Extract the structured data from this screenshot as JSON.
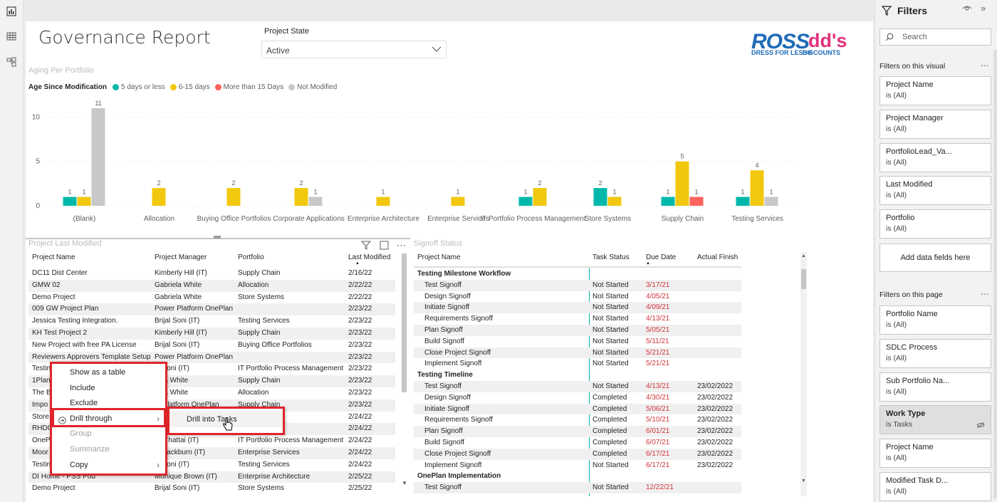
{
  "rail": {
    "icons": [
      "report-view-icon",
      "data-view-icon",
      "model-view-icon"
    ]
  },
  "report": {
    "title": "Governance Report"
  },
  "slicer": {
    "label": "Project State",
    "value": "Active"
  },
  "logo": {
    "ross": "ROSS",
    "ross_sub": "DRESS FOR LESS®",
    "dds": "dd's",
    "dds_sub": "DISCOUNTS"
  },
  "colors": {
    "five_days": "#01b8aa",
    "six_fifteen": "#f2c80f",
    "more_15": "#fd625e",
    "not_modified": "#c8c8c8",
    "accent_red": "#e0242b"
  },
  "chart_data": {
    "type": "bar",
    "title": "Aging Per Portfolio",
    "legend_title": "Age Since Modification",
    "legend_position": "top-left",
    "categories": [
      "(Blank)",
      "Allocation",
      "Buying Office Portfolios",
      "Corporate Applications",
      "Enterprise Architecture",
      "Enterprise Services",
      "IT Portfolio Process Management",
      "Store Systems",
      "Supply Chain",
      "Testing Services"
    ],
    "series": [
      {
        "name": "5 days or less",
        "values": [
          1,
          null,
          null,
          null,
          null,
          null,
          1,
          2,
          1,
          1
        ]
      },
      {
        "name": "6-15 days",
        "values": [
          1,
          2,
          2,
          2,
          1,
          1,
          2,
          1,
          5,
          4
        ]
      },
      {
        "name": "More than 15 Days",
        "values": [
          null,
          null,
          null,
          null,
          null,
          null,
          null,
          null,
          1,
          null
        ]
      },
      {
        "name": "Not Modified",
        "values": [
          11,
          null,
          null,
          1,
          null,
          null,
          null,
          null,
          null,
          1
        ]
      }
    ],
    "yticks": [
      0,
      5,
      10
    ],
    "ylim": [
      0,
      11
    ],
    "grid": true
  },
  "modified_table": {
    "title": "Project Last Modified",
    "columns": [
      "Project Name",
      "Project Manager",
      "Portfolio",
      "Last Modified"
    ],
    "rows": [
      [
        "DC11 Dist Center",
        "Kimberly Hill (IT)",
        "Supply Chain",
        "2/16/22"
      ],
      [
        "GMW 02",
        "Gabriela White",
        "Allocation",
        "2/22/22"
      ],
      [
        "Demo Project",
        "Gabriela White",
        "Store Systems",
        "2/22/22"
      ],
      [
        "009 GW Project Plan",
        "Power Platform OnePlan",
        "",
        "2/23/22"
      ],
      [
        "Jessica Testing Integration.",
        "Brijal Soni (IT)",
        "Testing Services",
        "2/23/22"
      ],
      [
        "KH Test Project 2",
        "Kimberly Hill (IT)",
        "Supply Chain",
        "2/23/22"
      ],
      [
        "New Project with free PA License",
        "Brijal Soni (IT)",
        "Buying Office Portfolios",
        "2/23/22"
      ],
      [
        "Reviewers Approvers Template Setup",
        "Power Platform OnePlan",
        "",
        "2/23/22"
      ],
      [
        "Testin",
        "al Soni (IT)",
        "IT Portfolio Process Management",
        "2/23/22"
      ],
      [
        "1Plan",
        "riela White",
        "Supply Chain",
        "2/23/22"
      ],
      [
        "The B",
        "riela White",
        "Allocation",
        "2/23/22"
      ],
      [
        "Impo",
        "er Platform OnePlan",
        "Supply Chain",
        "2/23/22"
      ],
      [
        "Store",
        "",
        "",
        "2/24/22"
      ],
      [
        "RHDC",
        "Simeona (IT)",
        "Supply Chain",
        "2/24/22"
      ],
      [
        "OneP",
        "ya Thattai (IT)",
        "IT Portfolio Process Management",
        "2/24/22"
      ],
      [
        "Moor",
        "n Blackburn (IT)",
        "Enterprise Services",
        "2/24/22"
      ],
      [
        "Testin",
        "al Soni (IT)",
        "Testing Services",
        "2/24/22"
      ],
      [
        "DI Home - PSS Pod",
        "Monique Brown (IT)",
        "Enterprise Architecture",
        "2/25/22"
      ],
      [
        "Demo Project",
        "Brijal Soni (IT)",
        "Store Systems",
        "2/25/22"
      ]
    ]
  },
  "signoff_table": {
    "title": "Signoff Status",
    "columns": [
      "Project Name",
      "Task Status",
      "Due Date",
      "Actual Finish"
    ],
    "rows": [
      {
        "group": "Testing Milestone Workflow"
      },
      {
        "name": "Test Signoff",
        "status": "Not Started",
        "due": "3/17/21",
        "finish": ""
      },
      {
        "name": "Design Signoff",
        "status": "Not Started",
        "due": "4/05/21",
        "finish": ""
      },
      {
        "name": "Initiate Signoff",
        "status": "Not Started",
        "due": "4/09/21",
        "finish": ""
      },
      {
        "name": "Requirements Signoff",
        "status": "Not Started",
        "due": "4/13/21",
        "finish": ""
      },
      {
        "name": "Plan Signoff",
        "status": "Not Started",
        "due": "5/05/21",
        "finish": ""
      },
      {
        "name": "Build Signoff",
        "status": "Not Started",
        "due": "5/11/21",
        "finish": ""
      },
      {
        "name": "Close Project Signoff",
        "status": "Not Started",
        "due": "5/21/21",
        "finish": ""
      },
      {
        "name": "Implement Signoff",
        "status": "Not Started",
        "due": "5/21/21",
        "finish": ""
      },
      {
        "group": "Testing Timeline"
      },
      {
        "name": "Test Signoff",
        "status": "Not Started",
        "due": "4/13/21",
        "finish": "23/02/2022"
      },
      {
        "name": "Design Signoff",
        "status": "Completed",
        "due": "4/30/21",
        "finish": "23/02/2022"
      },
      {
        "name": "Initiate Signoff",
        "status": "Completed",
        "due": "5/06/21",
        "finish": "23/02/2022"
      },
      {
        "name": "Requirements Signoff",
        "status": "Completed",
        "due": "5/10/21",
        "finish": "23/02/2022"
      },
      {
        "name": "Plan Signoff",
        "status": "Completed",
        "due": "6/01/21",
        "finish": "23/02/2022"
      },
      {
        "name": "Build Signoff",
        "status": "Completed",
        "due": "6/07/21",
        "finish": "23/02/2022"
      },
      {
        "name": "Close Project Signoff",
        "status": "Completed",
        "due": "6/17/21",
        "finish": "23/02/2022"
      },
      {
        "name": "Implement Signoff",
        "status": "Not Started",
        "due": "6/17/21",
        "finish": "23/02/2022"
      },
      {
        "group": "OnePlan Implementation"
      },
      {
        "name": "Test Signoff",
        "status": "Not Started",
        "due": "12/22/21",
        "finish": ""
      }
    ]
  },
  "context_menu": {
    "items": [
      {
        "label": "Show as a table",
        "disabled": false,
        "submenu": false
      },
      {
        "label": "Include",
        "disabled": false,
        "submenu": false
      },
      {
        "label": "Exclude",
        "disabled": false,
        "submenu": false
      },
      {
        "label": "Drill through",
        "disabled": false,
        "submenu": true
      },
      {
        "label": "Group",
        "disabled": true,
        "submenu": false
      },
      {
        "label": "Summarize",
        "disabled": true,
        "submenu": false
      },
      {
        "label": "Copy",
        "disabled": false,
        "submenu": true
      }
    ],
    "submenu_item": "Drill into Tasks"
  },
  "filters": {
    "title": "Filters",
    "search_placeholder": "Search",
    "visual_section": "Filters on this visual",
    "visual_cards": [
      {
        "name": "Project Name",
        "value": "is (All)"
      },
      {
        "name": "Project Manager",
        "value": "is (All)"
      },
      {
        "name": "PortfolioLead_Va...",
        "value": "is (All)"
      },
      {
        "name": "Last Modified",
        "value": "is (All)"
      },
      {
        "name": "Portfolio",
        "value": "is (All)"
      }
    ],
    "add_fields": "Add data fields here",
    "page_section": "Filters on this page",
    "page_cards": [
      {
        "name": "Portfolio Name",
        "value": "is (All)"
      },
      {
        "name": "SDLC Process",
        "value": "is (All)"
      },
      {
        "name": "Sub Portfolio Na...",
        "value": "is (All)"
      },
      {
        "name": "Work Type",
        "value": "is Tasks"
      },
      {
        "name": "Project Name",
        "value": "is (All)"
      },
      {
        "name": "Modified Task D...",
        "value": "is (All)"
      }
    ]
  }
}
